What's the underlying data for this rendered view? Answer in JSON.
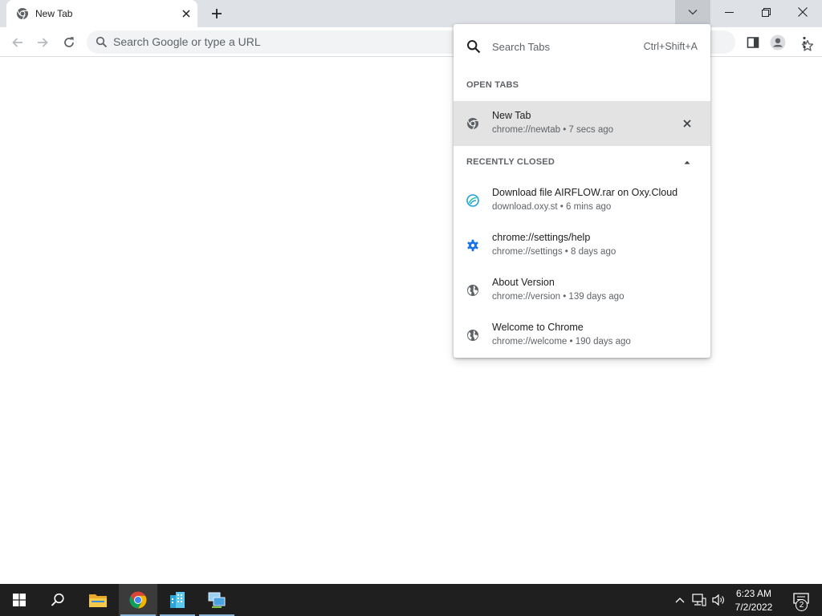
{
  "window": {
    "tab": {
      "title": "New Tab",
      "favicon": "chrome-icon"
    },
    "new_tab_icon": "plus-icon",
    "tab_search_icon": "chevron-down-icon"
  },
  "toolbar": {
    "omnibox_placeholder": "Search Google or type a URL"
  },
  "tab_search": {
    "placeholder": "Search Tabs",
    "shortcut": "Ctrl+Shift+A",
    "open_tabs_header": "OPEN TABS",
    "open_tabs": [
      {
        "title": "New Tab",
        "subtitle": "chrome://newtab • 7 secs ago",
        "icon": "chrome-icon",
        "selected": true
      }
    ],
    "recently_closed_header": "RECENTLY CLOSED",
    "recently_closed": [
      {
        "title": "Download file AIRFLOW.rar on Oxy.Cloud",
        "subtitle": "download.oxy.st • 6 mins ago",
        "icon": "oxy-cloud-icon"
      },
      {
        "title": "chrome://settings/help",
        "subtitle": "chrome://settings • 8 days ago",
        "icon": "settings-gear-icon"
      },
      {
        "title": "About Version",
        "subtitle": "chrome://version • 139 days ago",
        "icon": "globe-icon"
      },
      {
        "title": "Welcome to Chrome",
        "subtitle": "chrome://welcome • 190 days ago",
        "icon": "globe-icon"
      }
    ]
  },
  "taskbar": {
    "time": "6:23 AM",
    "date": "7/2/2022",
    "notification_count": "2"
  },
  "colors": {
    "tabstrip_bg": "#dee1e6",
    "omnibox_bg": "#f1f3f4",
    "selected_item_bg": "#e3e3e3",
    "taskbar_bg": "#1f1f1f",
    "settings_blue": "#1a73e8"
  }
}
